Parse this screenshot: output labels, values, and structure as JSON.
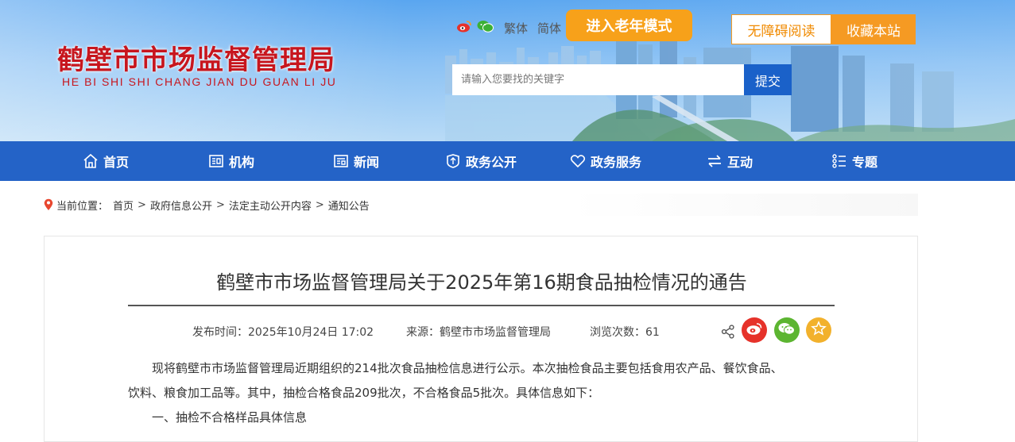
{
  "site": {
    "name_cn": "鹤壁市市场监督管理局",
    "name_pinyin": "HE BI SHI SHI CHANG JIAN DU GUAN LI JU"
  },
  "toplinks": {
    "traditional": "繁体",
    "simplified": "简体",
    "elder_mode": "进入老年模式",
    "accessibility": "无障碍阅读",
    "favorite": "收藏本站"
  },
  "search": {
    "placeholder": "请输入您要找的关键字",
    "value": "",
    "submit": "提交"
  },
  "nav": [
    {
      "label": "首页",
      "icon": "home-icon"
    },
    {
      "label": "机构",
      "icon": "org-icon"
    },
    {
      "label": "新闻",
      "icon": "news-icon"
    },
    {
      "label": "政务公开",
      "icon": "open-gov-icon"
    },
    {
      "label": "政务服务",
      "icon": "heart-icon"
    },
    {
      "label": "互动",
      "icon": "exchange-icon"
    },
    {
      "label": "专题",
      "icon": "topic-icon"
    }
  ],
  "breadcrumb": {
    "prefix": "当前位置：",
    "items": [
      "首页",
      "政府信息公开",
      "法定主动公开内容",
      "通知公告"
    ],
    "separator": ">"
  },
  "article": {
    "title": "鹤壁市市场监督管理局关于2025年第16期食品抽检情况的通告",
    "publish_time": "发布时间：2025年10月24日 17:02",
    "source": "来源：鹤壁市市场监督管理局",
    "views": "浏览次数：61",
    "para1_line1": "现将鹤壁市市场监督管理局近期组织的214批次食品抽检信息进行公示。本次抽检食品主要包括食用农产品、餐饮食品、",
    "para1_line2": "饮料、粮食加工品等。其中，抽检合格食品209批次，不合格食品5批次。具体信息如下：",
    "section1": "一、抽检不合格样品具体信息"
  },
  "colors": {
    "brand_red": "#c7161e",
    "nav_blue": "#2463c7",
    "orange": "#f59a23",
    "weibo_red": "#e6322a",
    "wechat_green": "#5cb531",
    "fav_yellow": "#f2b12c"
  }
}
